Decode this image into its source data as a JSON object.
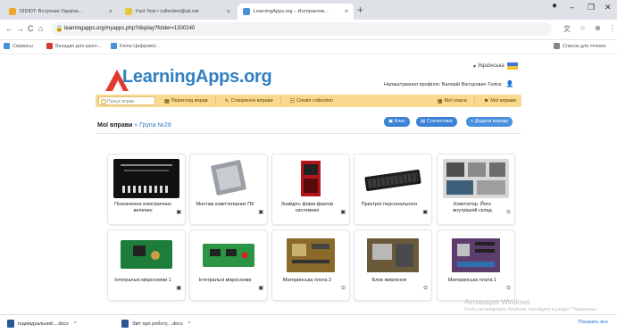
{
  "tabs": [
    {
      "title": "DIDIDT: Вступние Україна...",
      "color": "#f0a830"
    },
    {
      "title": "Fact Test • collection@uk.net",
      "color": "#e8c640"
    },
    {
      "title": "LearningApps.org – Интерактив...",
      "color": "#4a90d9"
    }
  ],
  "window_controls": {
    "minimize": "–",
    "maximize": "❐",
    "close": "✕"
  },
  "address": {
    "url": "learningapps.org/myapps.php?display?folder=1300240",
    "back": "←",
    "forward": "→",
    "reload": "C",
    "home": "⌂"
  },
  "bookmarks": [
    {
      "label": "Сервисы",
      "color": "#4a90d9"
    },
    {
      "label": "Вкладки для школ...",
      "color": "#d13b2f"
    },
    {
      "label": "Кліпи Цифрової...",
      "color": "#4a90d9"
    }
  ],
  "bookmarks_right": "Список для чтения",
  "site": {
    "logo": "LearningApps.org",
    "language": "Українська",
    "user_line": "Налаштування профілю: Валерій Вікторович Теліга",
    "search_placeholder": "Пошук вправ",
    "menu": [
      {
        "icon": "▦",
        "label": "Перегляд вправ"
      },
      {
        "icon": "✎",
        "label": "Створення вправи"
      },
      {
        "icon": "☷",
        "label": "Create collection"
      },
      {
        "icon": "▦",
        "label": "Мої класи"
      },
      {
        "icon": "⚑",
        "label": "Мої вправи"
      }
    ],
    "crumb_root": "Мої вправи",
    "crumb_sep": "»",
    "crumb_folder": "Група №28",
    "buttons": [
      {
        "label": "Клас"
      },
      {
        "label": "Статистика"
      },
      {
        "label": "+ Додати вправу"
      }
    ]
  },
  "cards": [
    {
      "title": "Позначення електричних величин",
      "icon": "▣",
      "theme": "dark"
    },
    {
      "title": "Монтаж комп'ютерних ПК",
      "icon": "▣",
      "theme": "cpu"
    },
    {
      "title": "Знайдіть форм-фактор системних",
      "icon": "▣",
      "theme": "case"
    },
    {
      "title": "Пристрої персонального",
      "icon": "▣",
      "theme": "keyboard"
    },
    {
      "title": "Комп'ютер. Його внутрішній склад",
      "icon": "⊙",
      "theme": "collage"
    },
    {
      "title": "Інтегральні мікросхеми 1",
      "icon": "▣",
      "theme": "board-green"
    },
    {
      "title": "Інтегральні мікросхеми",
      "icon": "▣",
      "theme": "board-green2"
    },
    {
      "title": "Материнська плата 2",
      "icon": "⊙",
      "theme": "mobo"
    },
    {
      "title": "Блок живлення",
      "icon": "⊙",
      "theme": "psu"
    },
    {
      "title": "Материнська плата 1",
      "icon": "⊙",
      "theme": "mobo2"
    }
  ],
  "watermark": {
    "title": "Активация Windows",
    "sub": "Чтобы активировать Windows, перейдите в раздел \"Параметры\"."
  },
  "downloads": [
    {
      "label": "Індивідуальний....docx",
      "arrow": "^"
    },
    {
      "label": "Звіт про роботу....docx",
      "arrow": "^"
    }
  ],
  "show_all": "Показать все"
}
